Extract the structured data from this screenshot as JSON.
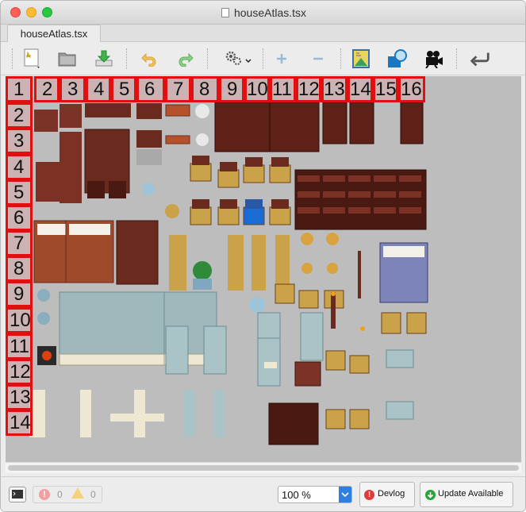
{
  "window": {
    "title": "houseAtlas.tsx",
    "tab_label": "houseAtlas.tsx"
  },
  "toolbar": {
    "buttons": [
      {
        "name": "new-file-icon",
        "label": ""
      },
      {
        "name": "open-folder-icon",
        "label": ""
      },
      {
        "name": "save-download-icon",
        "label": ""
      },
      {
        "name": "undo-icon",
        "label": ""
      },
      {
        "name": "redo-icon",
        "label": ""
      },
      {
        "name": "settings-gear-icon",
        "label": ""
      },
      {
        "name": "zoom-in-plus-icon",
        "label": ""
      },
      {
        "name": "zoom-out-minus-icon",
        "label": ""
      },
      {
        "name": "tileset-image-icon",
        "label": ""
      },
      {
        "name": "shape-overlay-icon",
        "label": ""
      },
      {
        "name": "video-camera-icon",
        "label": ""
      },
      {
        "name": "return-arrow-icon",
        "label": ""
      }
    ]
  },
  "grid_labels": {
    "columns": [
      "1",
      "2",
      "3",
      "4",
      "5",
      "6",
      "7",
      "8",
      "9",
      "10",
      "11",
      "12",
      "13",
      "14",
      "15",
      "16"
    ],
    "rows": [
      "2",
      "3",
      "4",
      "5",
      "6",
      "7",
      "8",
      "9",
      "10",
      "11",
      "12",
      "13",
      "14"
    ]
  },
  "status": {
    "errors": "0",
    "warnings": "0",
    "zoom": "100 %",
    "devlog_label": "Devlog",
    "update_label": "Update Available"
  },
  "colors": {
    "label_border": "#e01010",
    "canvas_bg": "#bdbdbd",
    "wood": "#6b2a1e",
    "cushion": "#c9a24a",
    "glass": "#9fb8bc"
  }
}
